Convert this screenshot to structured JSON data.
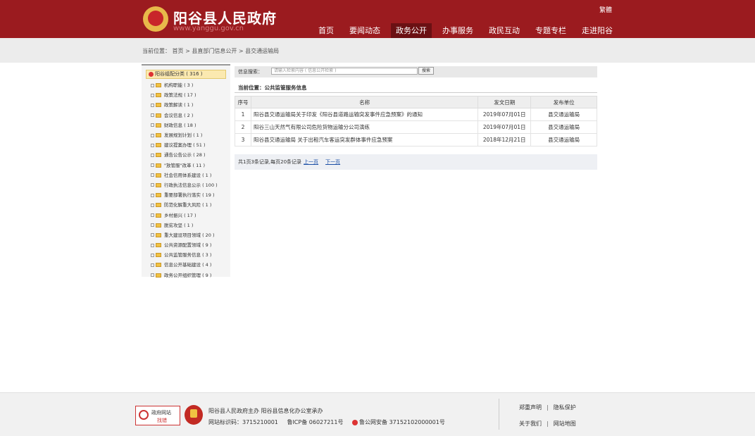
{
  "header": {
    "title": "阳谷县人民政府",
    "domain": "www.yanggu.gov.cn",
    "lang_switch": "繁體",
    "nav": [
      "首页",
      "要闻动态",
      "政务公开",
      "办事服务",
      "政民互动",
      "专题专栏",
      "走进阳谷"
    ],
    "nav_active_index": 2
  },
  "breadcrumb": "当前位置： 首页 > 县直部门信息公开 > 县交通运输局",
  "sidebar": {
    "root": "阳谷组配分类 ( 316 )",
    "items": [
      "机构职能 ( 3 )",
      "政策法规 ( 17 )",
      "政策解读 ( 1 )",
      "会议信息 ( 2 )",
      "财政信息 ( 18 )",
      "发展规划计划 ( 1 )",
      "建议提案办理 ( 51 )",
      "通告公告公示 ( 28 )",
      "\"放管服\"改革 ( 11 )",
      "社会信用体系建设 ( 1 )",
      "行政执法信息公示 ( 100 )",
      "重要部署执行落实 ( 19 )",
      "防范化解重大风险 ( 1 )",
      "乡村振兴 ( 17 )",
      "脱贫攻坚 ( 1 )",
      "重大建设项目领域 ( 20 )",
      "公共资源配置领域 ( 9 )",
      "公共监管服务信息 ( 3 )",
      "信息公开基础建设 ( 4 )",
      "政务公开组织管理 ( 9 )"
    ]
  },
  "search": {
    "label": "信息搜索：",
    "placeholder": "请输入检索内容 ( 信息公开检索 )",
    "button": "搜索"
  },
  "current_position": "当前位置：公共监管服务信息",
  "table": {
    "headers": [
      "序号",
      "名称",
      "发文日期",
      "发布单位"
    ],
    "rows": [
      {
        "no": "1",
        "name": "阳谷县交通运输局关于印发《阳谷县道路运输突发事件应急预案》的通知",
        "date": "2019年07月01日",
        "unit": "县交通运输局"
      },
      {
        "no": "2",
        "name": "阳谷三山天然气有限公司危险货物运输分公司演练",
        "date": "2019年07月01日",
        "unit": "县交通运输局"
      },
      {
        "no": "3",
        "name": "阳谷县交通运输局 关于出租汽车客运突发群体事件应急预案",
        "date": "2018年12月21日",
        "unit": "县交通运输局"
      }
    ]
  },
  "pager": {
    "summary": "共1页3条记录,每页20条记录",
    "prev": "上一页",
    "next": "下一页"
  },
  "footer": {
    "gov_badge_line1": "政府网站",
    "gov_badge_line2": "找错",
    "host": "阳谷县人民政府主办   阳谷县信息化办公室承办",
    "site_code": "网站标识码：3715210001",
    "icp": "鲁ICP备 06027211号",
    "police": "鲁公网安备 37152102000001号",
    "link_disclaimer": "郑重声明",
    "link_privacy": "隐私保护",
    "link_about": "关于我们",
    "link_sitemap": "网站地图"
  }
}
